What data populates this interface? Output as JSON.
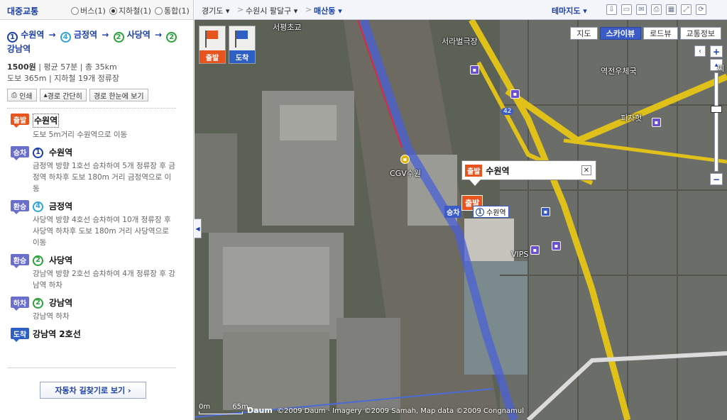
{
  "left_panel": {
    "title": "대중교통",
    "options": [
      {
        "label": "버스(1)",
        "selected": false
      },
      {
        "label": "지하철(1)",
        "selected": true
      },
      {
        "label": "통합(1)",
        "selected": false
      }
    ],
    "route": {
      "stops": [
        {
          "line": "1",
          "name": "수원역"
        },
        {
          "line": "4",
          "name": "금정역"
        },
        {
          "line": "2",
          "name": "사당역"
        },
        {
          "line": "2",
          "name": "강남역"
        }
      ],
      "arrow": "→",
      "fare": "1500원",
      "avg_time": "평균 57분",
      "distance": "총 35km",
      "walk": "도보 365m",
      "stations": "지하철 19개 정류장",
      "buttons": {
        "print": "인쇄",
        "simple": "경로 간단히",
        "overview": "경로 한눈에 보기"
      }
    },
    "steps": [
      {
        "badge": "출발",
        "type": "start",
        "line": "",
        "name": "수원역",
        "desc": "도보 5m거리 수원역으로 이동"
      },
      {
        "badge": "승차",
        "type": "board",
        "line": "1",
        "name": "수원역",
        "desc": "금정역 방향 1호선 승차하여 5개 정류장 후 금정역 하차후 도보 180m 거리 금정역으로 이동"
      },
      {
        "badge": "환승",
        "type": "xfer",
        "line": "4",
        "name": "금정역",
        "desc": "사당역 방향 4호선 승차하여 10개 정류장 후 사당역 하차후 도보 180m 거리 사당역으로 이동"
      },
      {
        "badge": "환승",
        "type": "xfer",
        "line": "2",
        "name": "사당역",
        "desc": "강남역 방향 2호선 승차하여 4개 정류장 후 강남역 하차"
      },
      {
        "badge": "하차",
        "type": "alight",
        "line": "2",
        "name": "강남역",
        "desc": "강남역 하차"
      },
      {
        "badge": "도착",
        "type": "arrive",
        "line": "",
        "name": "강남역 2호선",
        "desc": ""
      }
    ],
    "car_route_button": "자동차 길찾기로 보기 ›"
  },
  "topbar": {
    "crumbs": [
      "경기도 ▾",
      "수원시 팔달구 ▾",
      "매산동 ▾"
    ],
    "separator": ">",
    "theme": "테마지도 ▾",
    "tools": [
      "⇩",
      "▭",
      "✉",
      "⎙",
      "▦",
      "⤢",
      "⟳"
    ]
  },
  "map": {
    "types": [
      {
        "label": "지도",
        "active": false
      },
      {
        "label": "스카이뷰",
        "active": true
      },
      {
        "label": "로드뷰",
        "active": false
      },
      {
        "label": "교통정보",
        "active": false
      }
    ],
    "flags": [
      {
        "label": "출발",
        "color": "#e8541e"
      },
      {
        "label": "도착",
        "color": "#2d5fc4"
      }
    ],
    "zoom": {
      "plus": "+",
      "minus": "−",
      "up": "▴",
      "down": "▾",
      "level": 0.35
    },
    "pan": {
      "left": "‹",
      "right": "›"
    },
    "labels": [
      {
        "text": "서평초교"
      },
      {
        "text": "서라벌극장"
      },
      {
        "text": "역전우체국"
      },
      {
        "text": "피자헛"
      },
      {
        "text": "CGV수원"
      },
      {
        "text": "VIPS"
      },
      {
        "text": "씨"
      },
      {
        "text": "42"
      }
    ],
    "callout": {
      "tag": "출발",
      "name": "수원역",
      "close": "✕"
    },
    "start_pin": "출발",
    "board_tag": "승차",
    "station_label": {
      "line": "1",
      "name": "수원역"
    },
    "scale": {
      "left": "0m",
      "right": "65m"
    },
    "logo": "Daum",
    "copyright": "©2009 Daum · Imagery ©2009 Samah, Map data ©2009 Congnamul",
    "collapse": "◀"
  }
}
